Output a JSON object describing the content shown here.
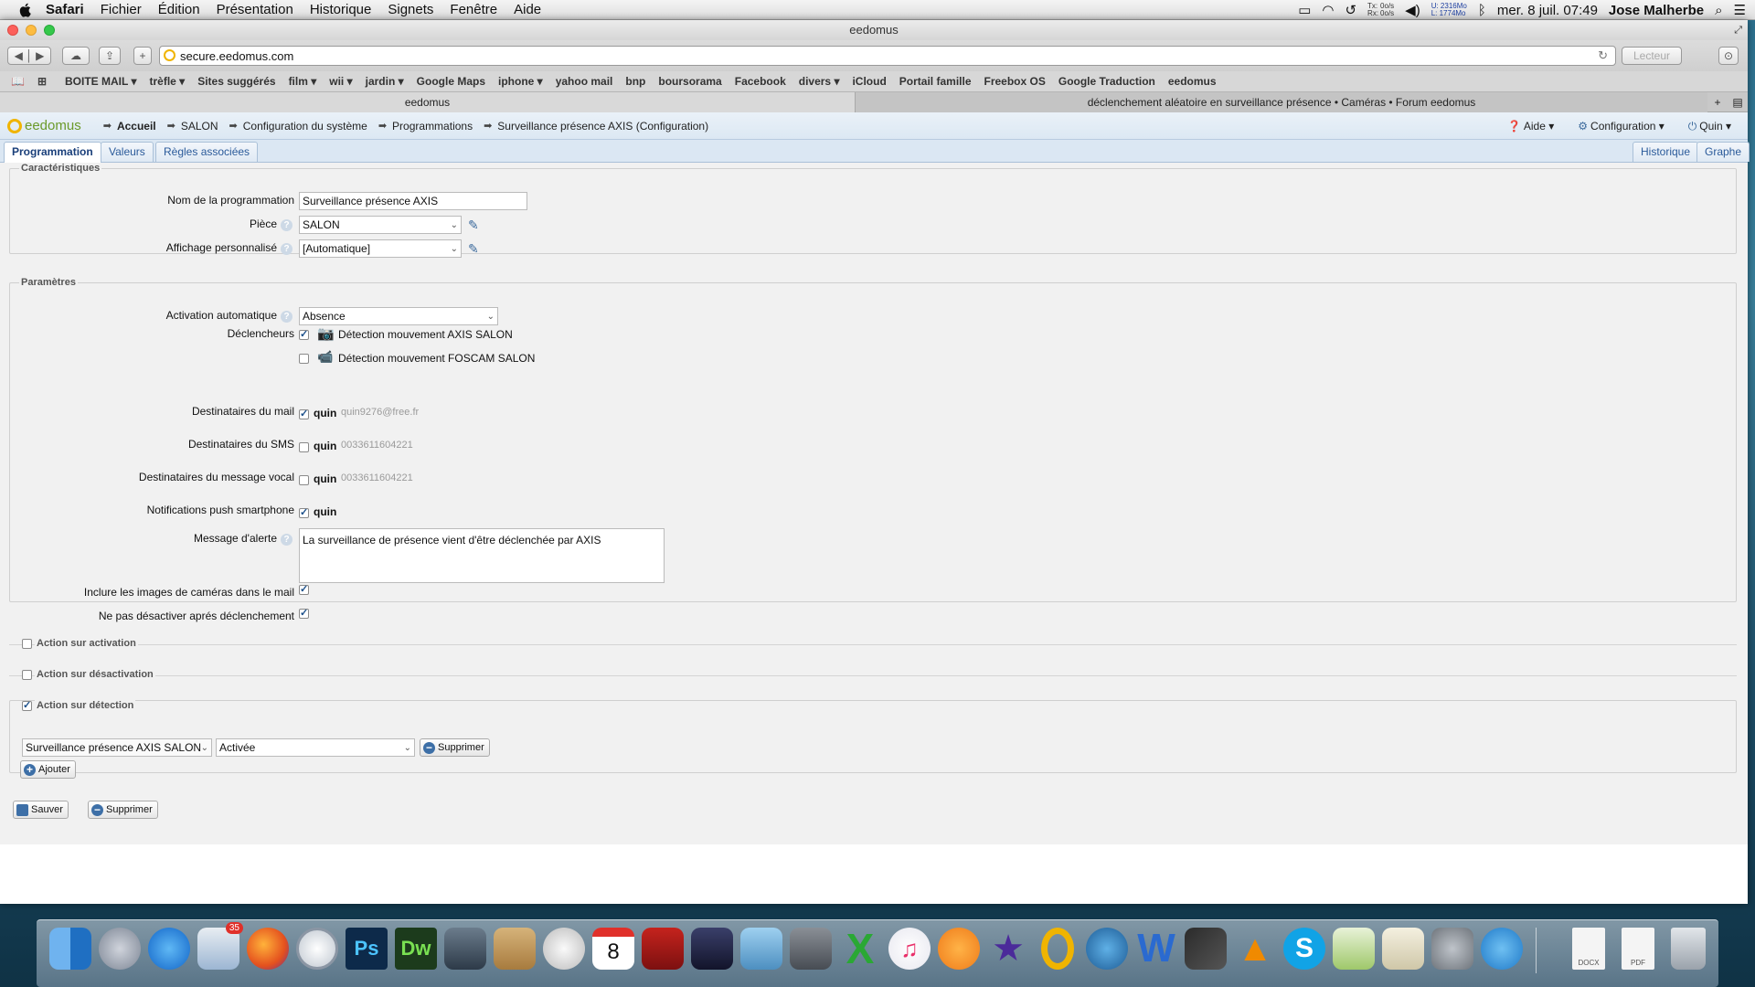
{
  "menubar": {
    "app": "Safari",
    "items": [
      "Fichier",
      "Édition",
      "Présentation",
      "Historique",
      "Signets",
      "Fenêtre",
      "Aide"
    ],
    "net_up": "0o/s",
    "net_down": "0o/s",
    "tx_label": "Tx:",
    "rx_label": "Rx:",
    "mem_used": "U: 2316Mo",
    "mem_free": "L: 1774Mo",
    "datetime": "mer. 8 juil.  07:49",
    "user": "Jose Malherbe"
  },
  "window": {
    "title": "eedomus",
    "url": "secure.eedomus.com",
    "reader_label": "Lecteur",
    "bookmarks": [
      "BOITE MAIL ▾",
      "trèfle ▾",
      "Sites suggérés",
      "film ▾",
      "wii ▾",
      "jardin ▾",
      "Google Maps",
      "iphone ▾",
      "yahoo mail",
      "bnp",
      "boursorama",
      "Facebook",
      "divers ▾",
      "iCloud",
      "Portail famille",
      "Freebox OS",
      "Google Traduction",
      "eedomus"
    ],
    "tabs": [
      {
        "label": "eedomus"
      },
      {
        "label": "déclenchement aléatoire en surveillance présence • Caméras • Forum eedomus"
      }
    ]
  },
  "app": {
    "logo": "eedomus",
    "breadcrumb": [
      "Accueil",
      "SALON",
      "Configuration du système",
      "Programmations",
      "Surveillance présence AXIS (Configuration)"
    ],
    "nav_right": {
      "help": "Aide ▾",
      "config": "Configuration ▾",
      "user": "Quin ▾"
    },
    "tabs": [
      "Programmation",
      "Valeurs",
      "Règles associées"
    ],
    "tabs_right": [
      "Historique",
      "Graphe"
    ]
  },
  "form": {
    "section_caracteristiques": "Caractéristiques",
    "name_label": "Nom de la programmation",
    "name_value": "Surveillance présence AXIS",
    "piece_label": "Pièce",
    "piece_value": "SALON",
    "affichage_label": "Affichage personnalisé",
    "affichage_value": "[Automatique]",
    "section_parametres": "Paramètres",
    "activation_label": "Activation automatique",
    "activation_value": "Absence",
    "declencheurs_label": "Déclencheurs",
    "trigger1": "Détection mouvement AXIS SALON",
    "trigger2": "Détection mouvement FOSCAM SALON",
    "mail_label": "Destinataires du mail",
    "mail_name": "quin",
    "mail_addr": "quin9276@free.fr",
    "sms_label": "Destinataires du SMS",
    "sms_name": "quin",
    "sms_num": "0033611604221",
    "vocal_label": "Destinataires du message vocal",
    "vocal_name": "quin",
    "vocal_num": "0033611604221",
    "push_label": "Notifications push smartphone",
    "push_name": "quin",
    "message_label": "Message d'alerte",
    "message_value": "La surveillance de présence vient d'être déclenchée par AXIS",
    "include_images_label": "Inclure les images de caméras dans le mail",
    "no_deactivate_label": "Ne pas désactiver aprés déclenchement",
    "action_activation": "Action sur activation",
    "action_desactivation": "Action sur désactivation",
    "action_detection": "Action sur détection",
    "detection_device": "Surveillance présence AXIS SALON",
    "detection_state": "Activée",
    "remove_label": "Supprimer",
    "add_label": "Ajouter",
    "save_label": "Sauver",
    "delete_label": "Supprimer"
  },
  "dock": {
    "mail_badge": "35",
    "calendar_day": "8",
    "docx_label": "DOCX",
    "pdf_label": "PDF"
  }
}
